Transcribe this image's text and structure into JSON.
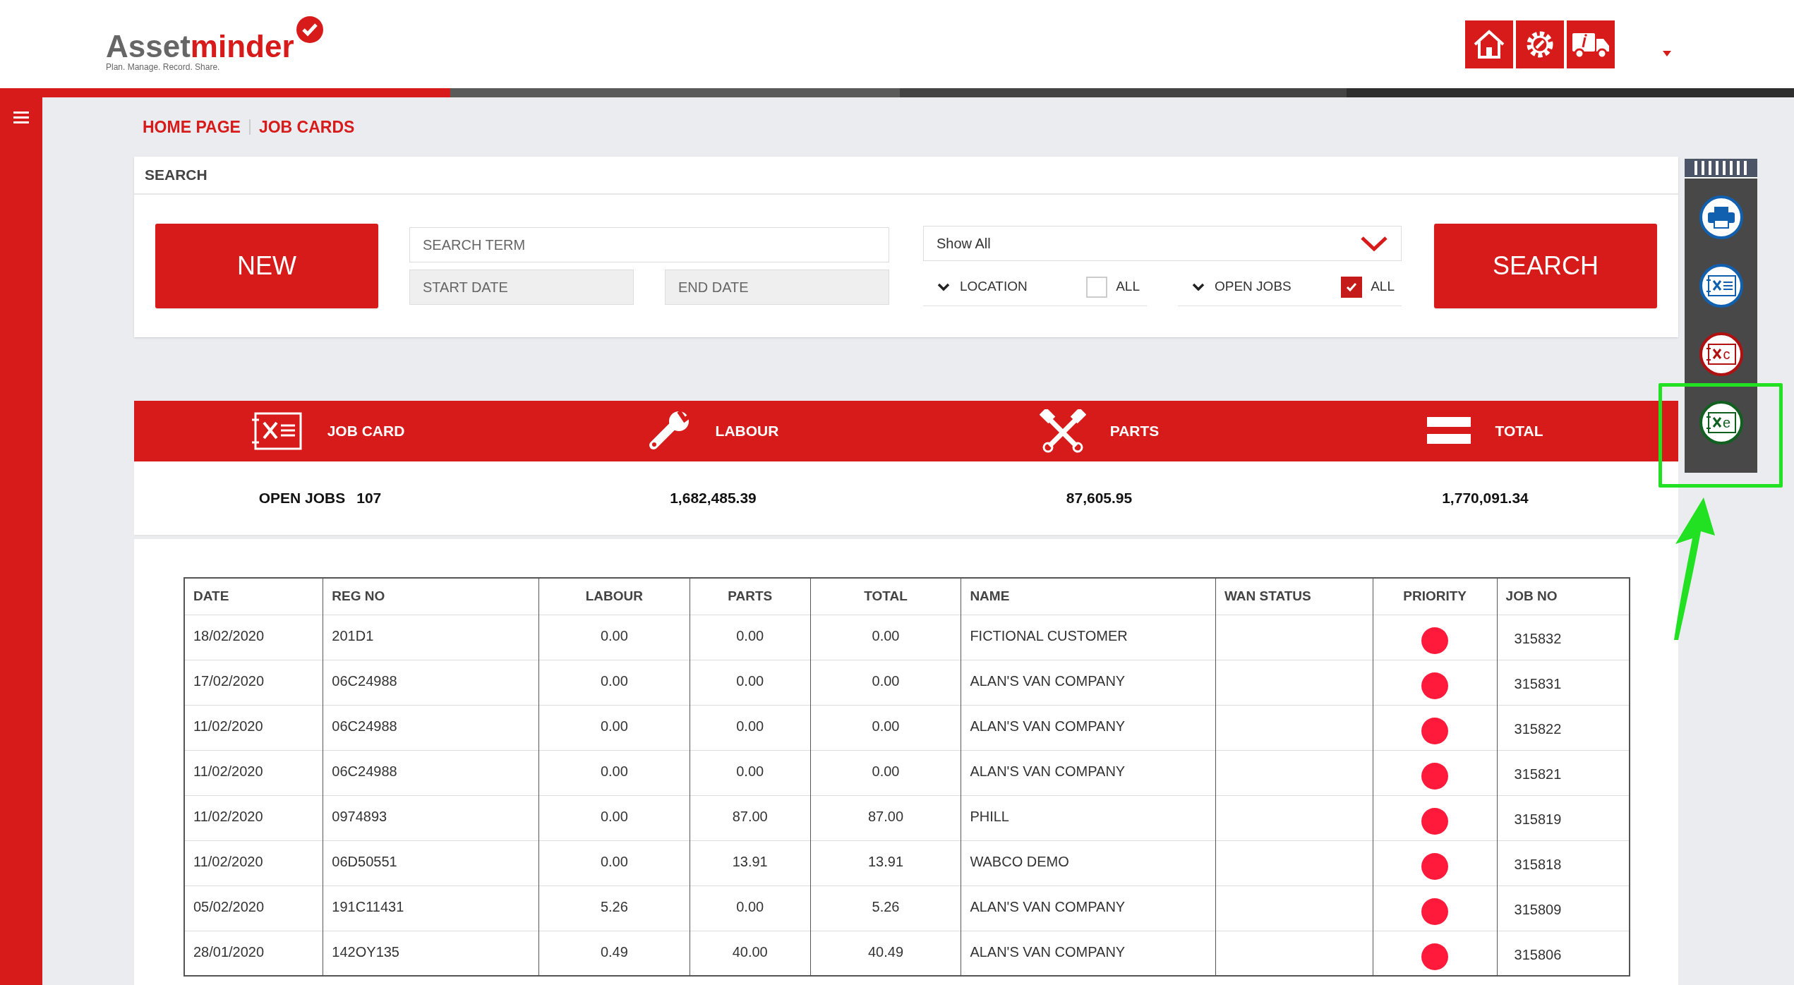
{
  "logo": {
    "name_a": "Asset",
    "name_b": "minder",
    "tagline": "Plan. Manage. Record. Share."
  },
  "breadcrumb": [
    "HOME PAGE",
    "JOB CARDS"
  ],
  "search_panel": {
    "title": "SEARCH",
    "new_button": "NEW",
    "search_term": {
      "placeholder": "SEARCH TERM"
    },
    "start_date": {
      "placeholder": "START DATE"
    },
    "end_date": {
      "placeholder": "END DATE"
    },
    "filter": {
      "value": "Show All"
    },
    "toggles": [
      {
        "label": "LOCATION",
        "all_label": "ALL",
        "checked": false
      },
      {
        "label": "OPEN JOBS",
        "all_label": "ALL",
        "checked": true
      }
    ],
    "search_button": "SEARCH"
  },
  "summary": {
    "headings": [
      {
        "kind": "jobcard",
        "label": "JOB CARD"
      },
      {
        "kind": "labour",
        "label": "LABOUR"
      },
      {
        "kind": "parts",
        "label": "PARTS"
      },
      {
        "kind": "total",
        "label": "TOTAL"
      }
    ],
    "open_jobs_label": "OPEN JOBS",
    "open_jobs_count": "107",
    "labour": "1,682,485.39",
    "parts": "87,605.95",
    "total": "1,770,091.34"
  },
  "table": {
    "columns": [
      "DATE",
      "REG NO",
      "LABOUR",
      "PARTS",
      "TOTAL",
      "NAME",
      "WAN STATUS",
      "PRIORITY",
      "JOB NO"
    ],
    "rows": [
      {
        "date": "18/02/2020",
        "reg": "201D1",
        "labour": "0.00",
        "parts": "0.00",
        "total": "0.00",
        "name": "FICTIONAL CUSTOMER",
        "color": "#ff1a3c",
        "job": "315832"
      },
      {
        "date": "17/02/2020",
        "reg": "06C24988",
        "labour": "0.00",
        "parts": "0.00",
        "total": "0.00",
        "name": "ALAN'S VAN COMPANY",
        "color": "#ff1a3c",
        "job": "315831"
      },
      {
        "date": "11/02/2020",
        "reg": "06C24988",
        "labour": "0.00",
        "parts": "0.00",
        "total": "0.00",
        "name": "ALAN'S VAN COMPANY",
        "color": "#ff1a3c",
        "job": "315822"
      },
      {
        "date": "11/02/2020",
        "reg": "06C24988",
        "labour": "0.00",
        "parts": "0.00",
        "total": "0.00",
        "name": "ALAN'S VAN COMPANY",
        "color": "#ff1a3c",
        "job": "315821"
      },
      {
        "date": "11/02/2020",
        "reg": "0974893",
        "labour": "0.00",
        "parts": "87.00",
        "total": "87.00",
        "name": "PHILL",
        "color": "#ff1a3c",
        "job": "315819"
      },
      {
        "date": "11/02/2020",
        "reg": "06D50551",
        "labour": "0.00",
        "parts": "13.91",
        "total": "13.91",
        "name": "WABCO DEMO",
        "color": "#ff1a3c",
        "job": "315818"
      },
      {
        "date": "05/02/2020",
        "reg": "191C11431",
        "labour": "5.26",
        "parts": "0.00",
        "total": "5.26",
        "name": "ALAN'S VAN COMPANY",
        "color": "#ff1a3c",
        "job": "315809"
      },
      {
        "date": "28/01/2020",
        "reg": "142OY135",
        "labour": "0.49",
        "parts": "40.00",
        "total": "40.49",
        "name": "ALAN'S VAN COMPANY",
        "color": "#ff1a3c",
        "job": "315806"
      }
    ]
  },
  "side_tools": [
    {
      "kind": "print"
    },
    {
      "kind": "jobcard"
    },
    {
      "kind": "jobcard_c",
      "letter": "c"
    },
    {
      "kind": "jobcard_e",
      "letter": "e"
    }
  ]
}
